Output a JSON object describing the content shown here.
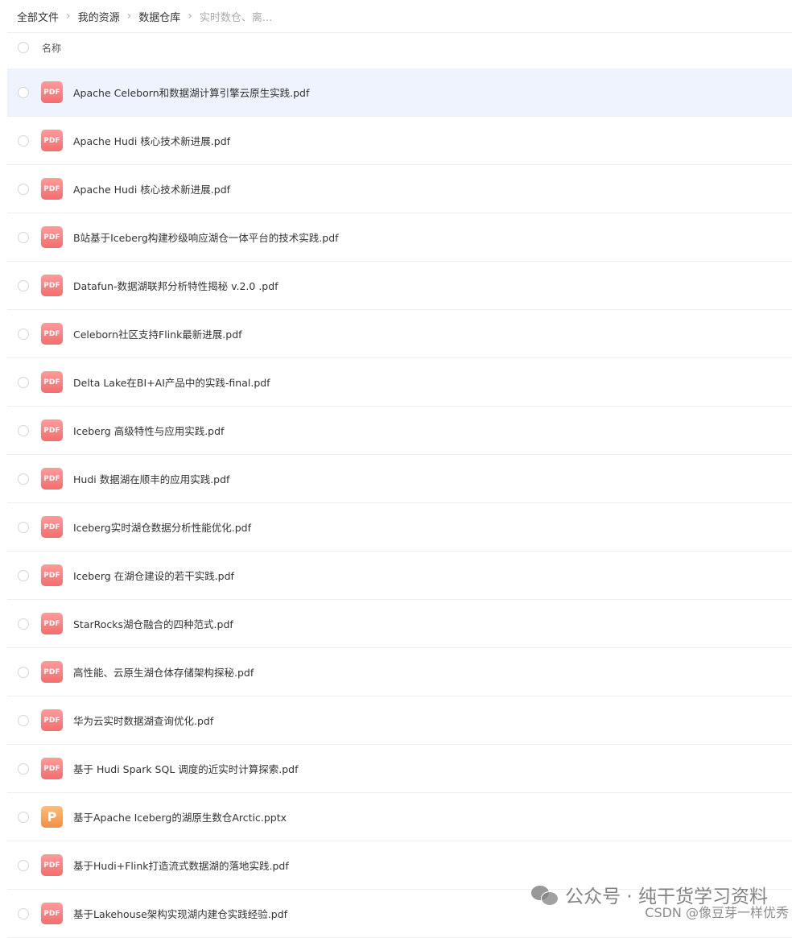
{
  "breadcrumb": {
    "items": [
      "全部文件",
      "我的资源",
      "数据仓库"
    ],
    "current": "实时数仓、离..."
  },
  "header": {
    "name_label": "名称"
  },
  "files": [
    {
      "name": "Apache Celeborn和数据湖计算引擎云原生实践.pdf",
      "icon": "PDF",
      "type": "pdf",
      "selected": true
    },
    {
      "name": "Apache Hudi 核心技术新进展.pdf",
      "icon": "PDF",
      "type": "pdf"
    },
    {
      "name": "Apache Hudi 核心技术新进展.pdf",
      "icon": "PDF",
      "type": "pdf"
    },
    {
      "name": "B站基于Iceberg构建秒级响应湖仓一体平台的技术实践.pdf",
      "icon": "PDF",
      "type": "pdf"
    },
    {
      "name": "Datafun-数据湖联邦分析特性揭秘 v.2.0 .pdf",
      "icon": "PDF",
      "type": "pdf"
    },
    {
      "name": "Celeborn社区支持Flink最新进展.pdf",
      "icon": "PDF",
      "type": "pdf"
    },
    {
      "name": "Delta Lake在BI+AI产品中的实践-final.pdf",
      "icon": "PDF",
      "type": "pdf"
    },
    {
      "name": "Iceberg 高级特性与应用实践.pdf",
      "icon": "PDF",
      "type": "pdf"
    },
    {
      "name": "Hudi 数据湖在顺丰的应用实践.pdf",
      "icon": "PDF",
      "type": "pdf"
    },
    {
      "name": "Iceberg实时湖仓数据分析性能优化.pdf",
      "icon": "PDF",
      "type": "pdf"
    },
    {
      "name": "Iceberg 在湖仓建设的若干实践.pdf",
      "icon": "PDF",
      "type": "pdf"
    },
    {
      "name": "StarRocks湖仓融合的四种范式.pdf",
      "icon": "PDF",
      "type": "pdf"
    },
    {
      "name": "高性能、云原生湖仓体存储架构探秘.pdf",
      "icon": "PDF",
      "type": "pdf"
    },
    {
      "name": "华为云实时数据湖查询优化.pdf",
      "icon": "PDF",
      "type": "pdf"
    },
    {
      "name": "基于 Hudi Spark SQL 调度的近实时计算探索.pdf",
      "icon": "PDF",
      "type": "pdf"
    },
    {
      "name": "基于Apache Iceberg的湖原生数仓Arctic.pptx",
      "icon": "P",
      "type": "pptx"
    },
    {
      "name": "基于Hudi+Flink打造流式数据湖的落地实践.pdf",
      "icon": "PDF",
      "type": "pdf"
    },
    {
      "name": "基于Lakehouse架构实现湖内建仓实践经验.pdf",
      "icon": "PDF",
      "type": "pdf"
    }
  ],
  "watermark": {
    "text": "公众号 · 纯干货学习资料",
    "csdn": "CSDN @像豆芽一样优秀",
    "icon": "wechat-icon"
  },
  "colors": {
    "selected_row": "#eef3fd",
    "pdf_icon": "#f26d6d",
    "pptx_icon": "#f28e44"
  }
}
